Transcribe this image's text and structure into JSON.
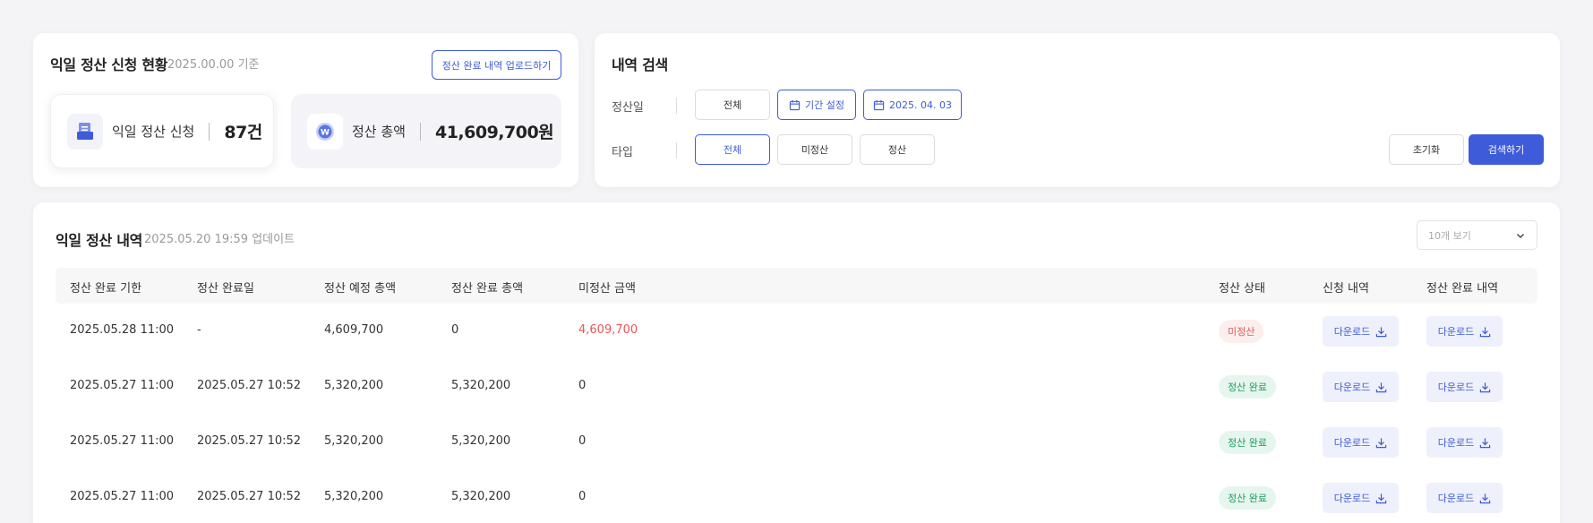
{
  "summary": {
    "title": "익일 정산 신청 현황",
    "date_basis": "2025.00.00 기준",
    "upload_button": "정산 완료 내역 업로드하기",
    "count_label": "익일 정산 신청",
    "count_value": "87건",
    "total_label": "정산 총액",
    "total_value": "41,609,700원",
    "total_icon_letter": "W"
  },
  "search": {
    "title": "내역 검색",
    "date_row_label": "정산일",
    "date_options": [
      "전체",
      "기간 설정",
      "2025. 04. 03"
    ],
    "type_row_label": "타입",
    "type_options": [
      "전체",
      "미정산",
      "정산"
    ],
    "reset_button": "초기화",
    "search_button": "검색하기"
  },
  "history": {
    "title": "익일 정산 내역",
    "updated": "2025.05.20 19:59 업데이트",
    "page_size_placeholder": "10개 보기",
    "columns": [
      "정산 완료 기한",
      "정산 완료일",
      "정산 예정 총액",
      "정산 완료 총액",
      "미정산 금액",
      "정산 상태",
      "신청 내역",
      "정산 완료 내역"
    ],
    "download_label": "다운로드",
    "rows": [
      {
        "deadline": "2025.05.28 11:00",
        "completed": "-",
        "expected": "4,609,700",
        "settled": "0",
        "unsettled": "4,609,700",
        "status": "미정산",
        "status_type": "pending"
      },
      {
        "deadline": "2025.05.27 11:00",
        "completed": "2025.05.27 10:52",
        "expected": "5,320,200",
        "settled": "5,320,200",
        "unsettled": "0",
        "status": "정산 완료",
        "status_type": "done"
      },
      {
        "deadline": "2025.05.27 11:00",
        "completed": "2025.05.27 10:52",
        "expected": "5,320,200",
        "settled": "5,320,200",
        "unsettled": "0",
        "status": "정산 완료",
        "status_type": "done"
      },
      {
        "deadline": "2025.05.27 11:00",
        "completed": "2025.05.27 10:52",
        "expected": "5,320,200",
        "settled": "5,320,200",
        "unsettled": "0",
        "status": "정산 완료",
        "status_type": "done"
      }
    ]
  },
  "colors": {
    "accent": "#3e5bd9",
    "pending_text": "#e05a5a",
    "done_text": "#1f9a62",
    "unsettled_red": "#ef5454"
  }
}
